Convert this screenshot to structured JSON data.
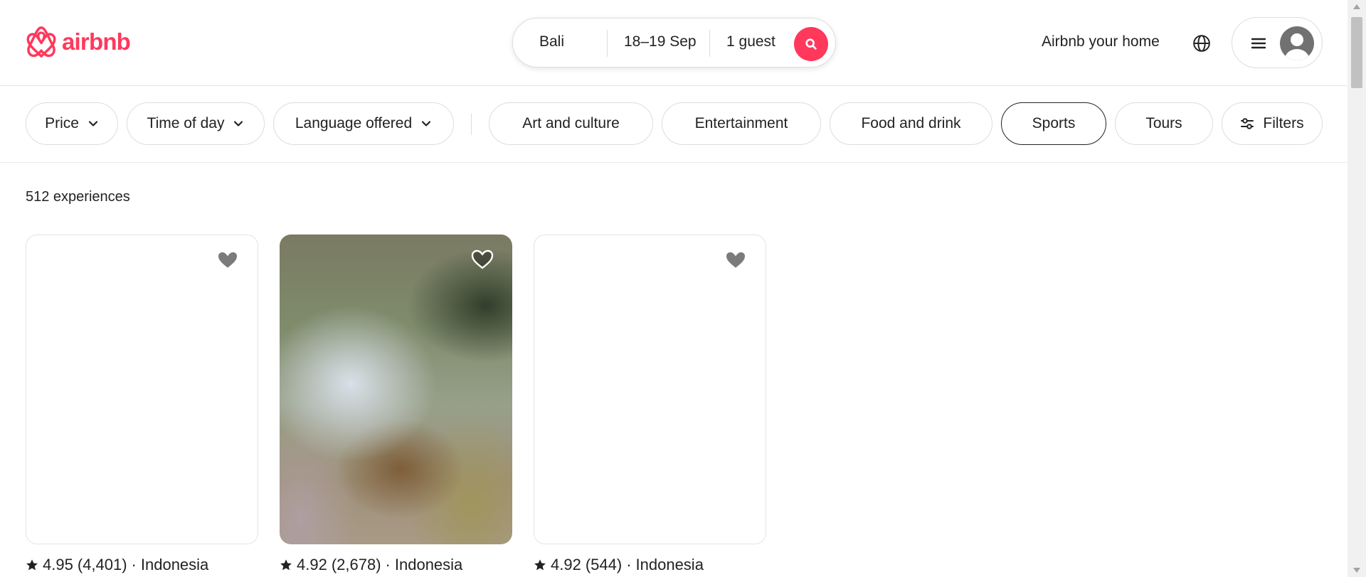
{
  "brand": {
    "name": "airbnb",
    "color": "#ff385c",
    "logo_icon": "airbnb-belo-logo"
  },
  "search": {
    "location": "Bali",
    "dates": "18–19 Sep",
    "guests": "1 guest",
    "search_icon": "search-icon"
  },
  "header": {
    "host_link": "Airbnb your home",
    "globe_icon": "globe-icon",
    "menu_icon": "hamburger-menu-icon",
    "avatar_icon": "user-avatar-icon"
  },
  "filters": {
    "dropdowns": [
      {
        "label": "Price"
      },
      {
        "label": "Time of day"
      },
      {
        "label": "Language offered"
      }
    ],
    "categories": [
      {
        "label": "Art and culture",
        "selected": false
      },
      {
        "label": "Entertainment",
        "selected": false
      },
      {
        "label": "Food and drink",
        "selected": false
      },
      {
        "label": "Sports",
        "selected": true
      },
      {
        "label": "Tours",
        "selected": false
      }
    ],
    "filters_button": "Filters"
  },
  "results": {
    "count_label": "512 experiences",
    "cards": [
      {
        "rating": "4.95",
        "reviews": "(4,401)",
        "location": "Indonesia",
        "has_image": false
      },
      {
        "rating": "4.92",
        "reviews": "(2,678)",
        "location": "Indonesia",
        "has_image": true
      },
      {
        "rating": "4.92",
        "reviews": "(544)",
        "location": "Indonesia",
        "has_image": false
      }
    ]
  },
  "colors": {
    "accent": "#ff385c",
    "text": "#222222",
    "border": "#dddddd"
  }
}
